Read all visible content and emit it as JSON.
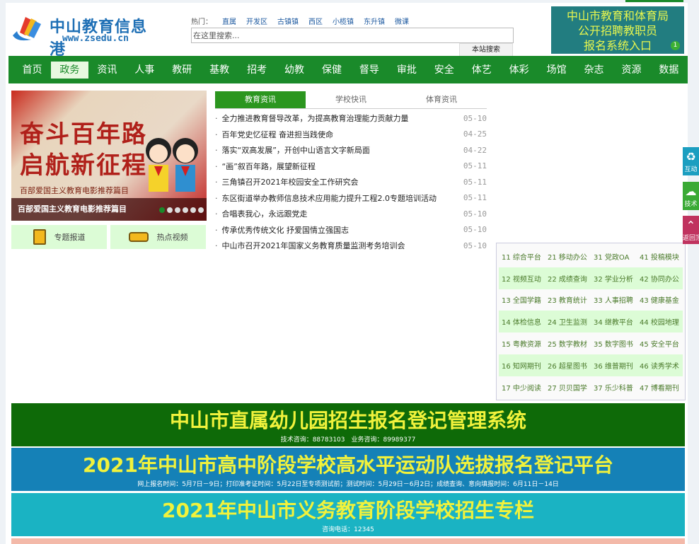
{
  "logo": {
    "name": "中山教育信息港",
    "url": "www.zsedu.cn"
  },
  "hot": {
    "label": "热门：",
    "links": [
      "直属",
      "开发区",
      "古镇镇",
      "西区",
      "小榄镇",
      "东升镇",
      "微课"
    ]
  },
  "search": {
    "placeholder": "在这里搜索...",
    "button": "本站搜索"
  },
  "recruit": {
    "lines": [
      "中山市教育和体育局",
      "公开招聘教职员",
      "报名系统入口"
    ],
    "badge": "1"
  },
  "nav": [
    "首页",
    "政务",
    "资讯",
    "人事",
    "教研",
    "基教",
    "招考",
    "幼教",
    "保健",
    "督导",
    "审批",
    "安全",
    "体艺",
    "体彩",
    "场馆",
    "杂志",
    "资源",
    "数据"
  ],
  "slide": {
    "title1": "奋斗百年路",
    "title2": "启航新征程",
    "subtitle": "百部爱国主义教育电影推荐篇目",
    "caption": "百部爱国主义教育电影推荐篇目",
    "active_dot": 1,
    "dot_count": 6
  },
  "quick": [
    "专题报道",
    "热点视频"
  ],
  "tabs": [
    "教育资讯",
    "学校快讯",
    "体育资讯"
  ],
  "news": [
    {
      "t": "全力推进教育督导改革，为提高教育治理能力贡献力量",
      "d": "05-10"
    },
    {
      "t": "百年党史忆征程 奋进担当践使命",
      "d": "04-25"
    },
    {
      "t": "落实“双高发展”，开创中山语言文字新局面",
      "d": "04-22"
    },
    {
      "t": "“画”叙百年路，展望新征程",
      "d": "05-11"
    },
    {
      "t": "三角镇召开2021年校园安全工作研究会",
      "d": "05-11"
    },
    {
      "t": "东区街道举办教师信息技术应用能力提升工程2.0专题培训活动",
      "d": "05-11"
    },
    {
      "t": "合唱表我心，永远跟党走",
      "d": "05-10"
    },
    {
      "t": "传承优秀传统文化 抒爱国情立强国志",
      "d": "05-10"
    },
    {
      "t": "中山市召开2021年国家义务教育质量监测考务培训会",
      "d": "05-10"
    }
  ],
  "grid": [
    [
      "11 综合平台",
      "21 移动办公",
      "31 党政OA",
      "41 投稿模块"
    ],
    [
      "12 视频互动",
      "22 成绩查询",
      "32 学业分析",
      "42 协同办公"
    ],
    [
      "13 全国学籍",
      "23 教育统计",
      "33 人事招聘",
      "43 健康基金"
    ],
    [
      "14 体检信息",
      "24 卫生监测",
      "34 继教平台",
      "44 校园地理"
    ],
    [
      "15 粤教资源",
      "25 数字教材",
      "35 数字图书",
      "45 安全平台"
    ],
    [
      "16 知网期刊",
      "26 超星图书",
      "36 维普期刊",
      "46 读秀学术"
    ],
    [
      "17 中少阅读",
      "27 贝贝国学",
      "37 乐少科普",
      "47 博看期刊"
    ]
  ],
  "banners": [
    {
      "h": "中山市直属幼儿园招生报名登记管理系统",
      "s": "技术咨询：88783103　业务咨询：89989377",
      "bg": "#0e6a08"
    },
    {
      "h": "2021年中山市高中阶段学校高水平运动队选拔报名登记平台",
      "s": "网上报名时间：5月7日－9日；打印准考证时间：5月22日至专项测试前；测试时间：5月29日－6月2日；成绩查询、意向填报时间：6月11日－14日",
      "bg": "#1581b7"
    },
    {
      "h": "2021年中山市义务教育阶段学校招生专栏",
      "s": "咨询电话：12345",
      "bg": "#1ab3c3"
    }
  ],
  "side": [
    {
      "label": "互动",
      "color": "#1b9ec0"
    },
    {
      "label": "技术",
      "color": "#3aaa35"
    },
    {
      "label": "返回顶部",
      "color": "#c0335f"
    }
  ]
}
